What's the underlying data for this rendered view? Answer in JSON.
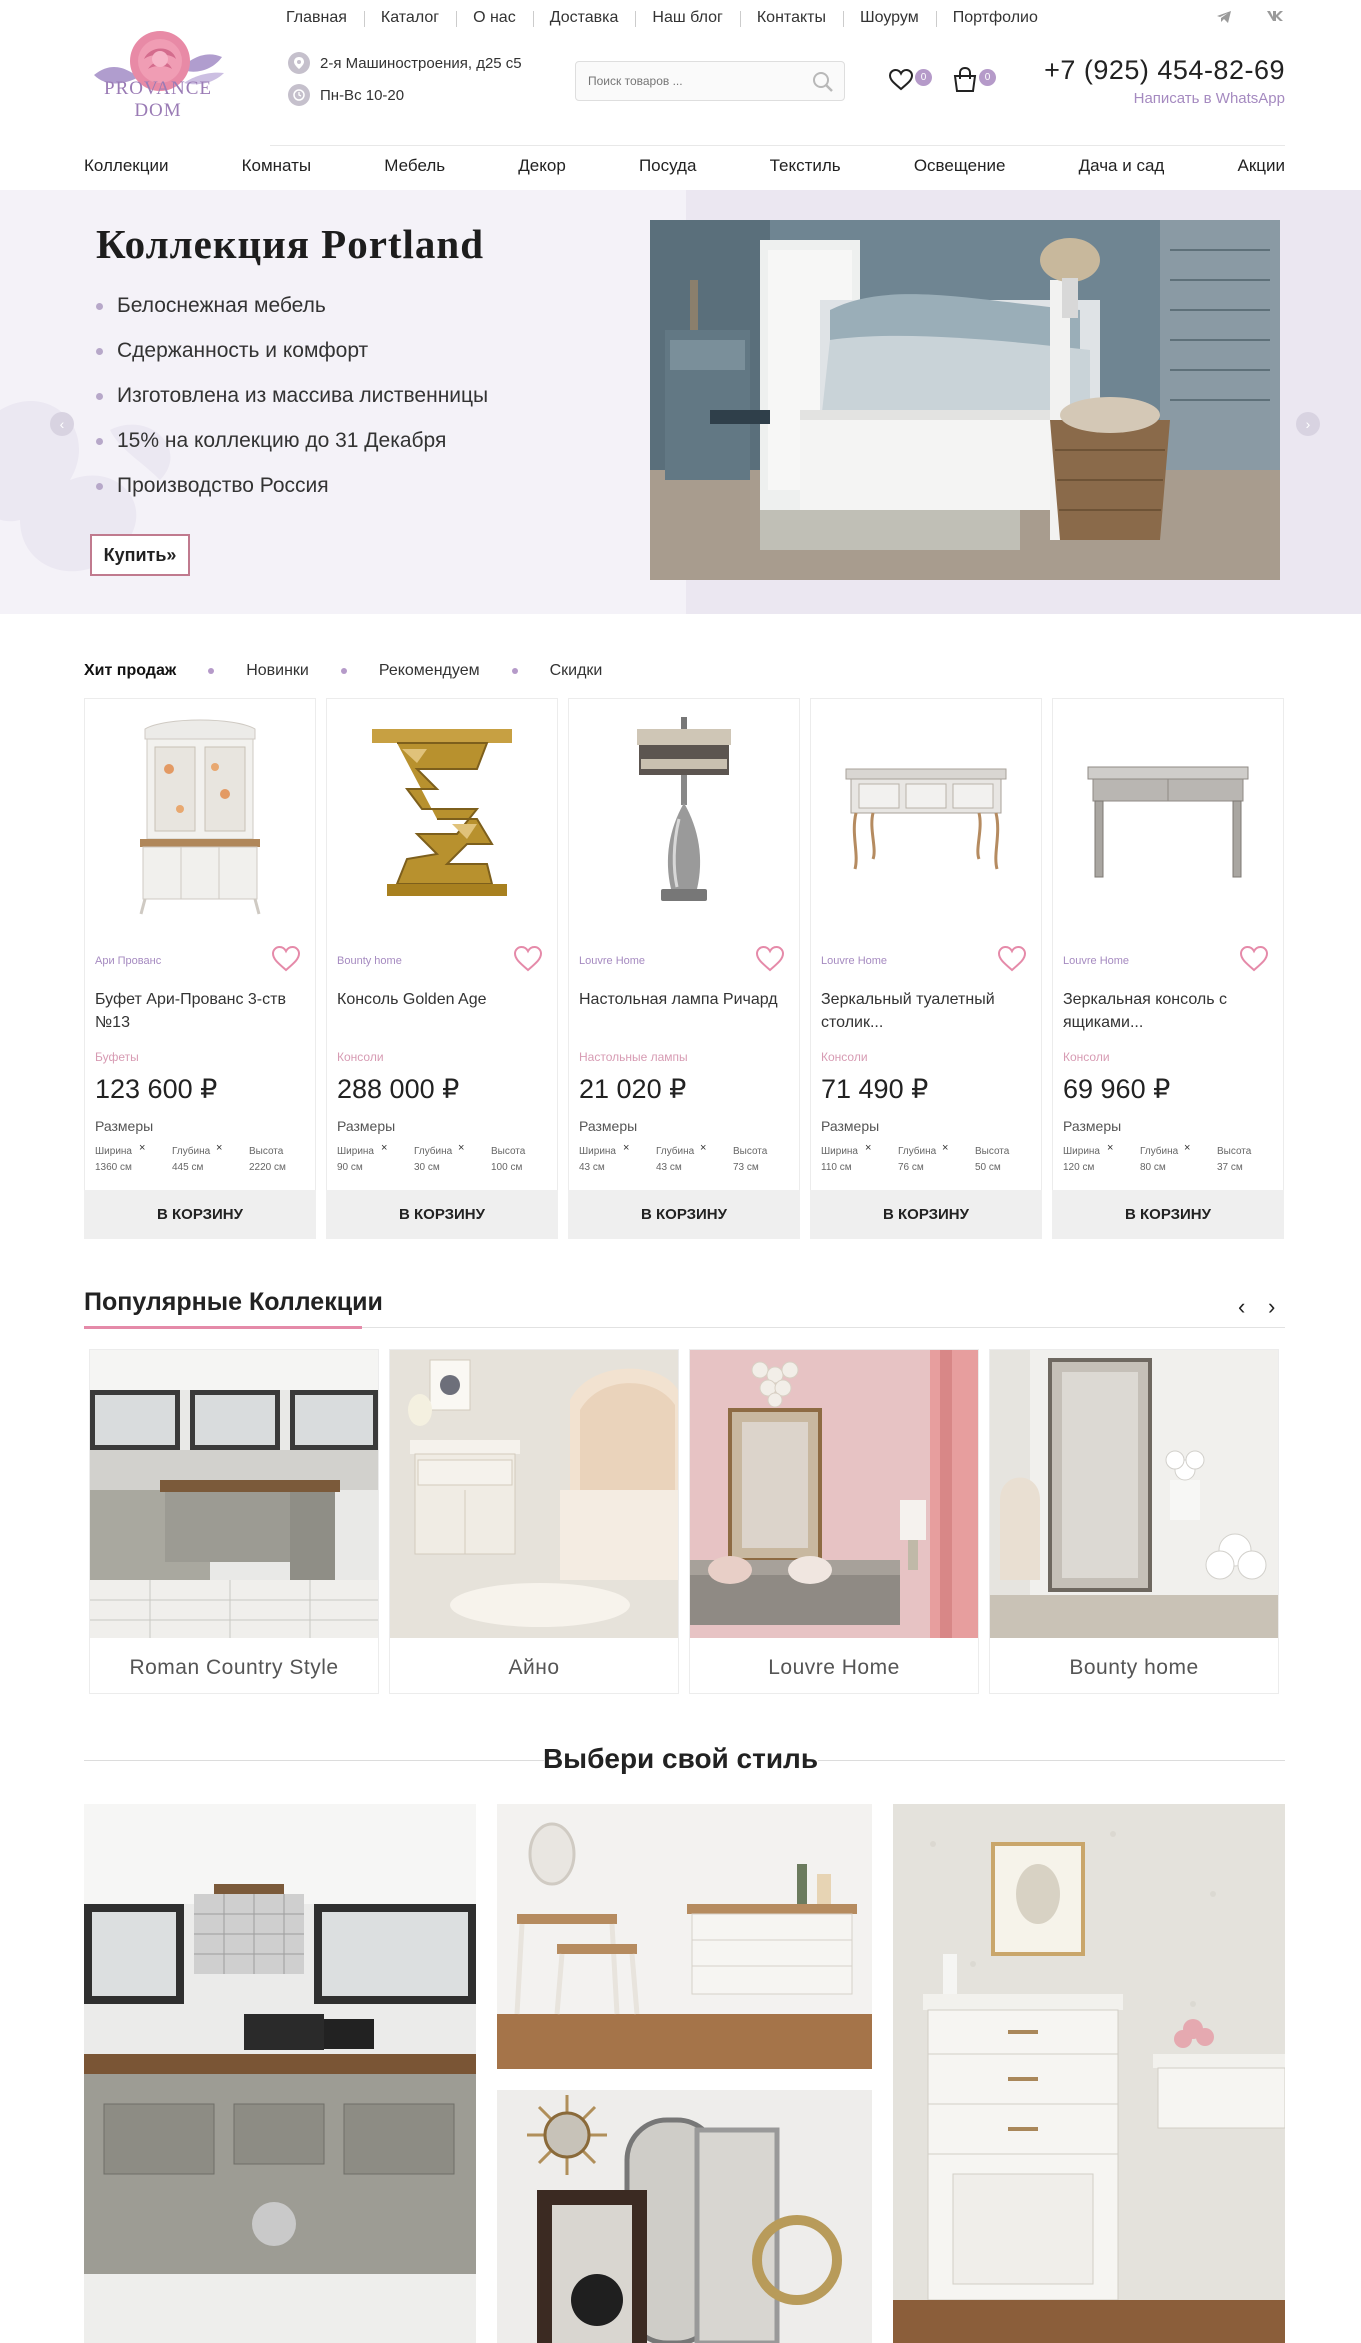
{
  "brand": {
    "line1": "PROVANCE",
    "line2": "DOM"
  },
  "top_nav": [
    "Главная",
    "Каталог",
    "О нас",
    "Доставка",
    "Наш блог",
    "Контакты",
    "Шоурум",
    "Портфолио"
  ],
  "social": {
    "telegram": "telegram-icon",
    "vk": "vk-icon"
  },
  "contact": {
    "address": "2-я Машиностроения, д25 с5",
    "hours": "Пн-Вс 10-20"
  },
  "search": {
    "placeholder": "Поиск товаров ..."
  },
  "header_counts": {
    "favorites": "0",
    "cart": "0"
  },
  "phone": {
    "number": "+7 (925) 454-82-69",
    "whatsapp": "Написать в WhatsApp"
  },
  "main_nav": [
    "Коллекции",
    "Комнаты",
    "Мебель",
    "Декор",
    "Посуда",
    "Текстиль",
    "Освещение",
    "Дача и сад",
    "Акции"
  ],
  "hero": {
    "title": "Коллекция Portland",
    "features": [
      "Белоснежная мебель",
      "Сдержанность и комфорт",
      "Изготовлена из массива лиственницы",
      "15% на коллекцию до 31 Декабря",
      "Производство Россия"
    ],
    "button": "Купить»",
    "arrow_left": "‹",
    "arrow_right": "›"
  },
  "tabs": [
    "Хит продаж",
    "Новинки",
    "Рекомендуем",
    "Скидки"
  ],
  "products": [
    {
      "brand": "Ари Прованс",
      "name": "Буфет Ари-Прованс 3-ств №13",
      "category": "Буфеты",
      "price": "123 600 ₽",
      "sizes_label": "Размеры",
      "dims": [
        {
          "label": "Ширина",
          "value": "1360 см"
        },
        {
          "label": "Глубина",
          "value": "445 см"
        },
        {
          "label": "Высота",
          "value": "2220 см"
        }
      ],
      "cart": "В КОРЗИНУ"
    },
    {
      "brand": "Bounty home",
      "name": "Консоль Golden Age",
      "category": "Консоли",
      "price": "288 000 ₽",
      "sizes_label": "Размеры",
      "dims": [
        {
          "label": "Ширина",
          "value": "90 см"
        },
        {
          "label": "Глубина",
          "value": "30 см"
        },
        {
          "label": "Высота",
          "value": "100 см"
        }
      ],
      "cart": "В КОРЗИНУ"
    },
    {
      "brand": "Louvre Home",
      "name": "Настольная лампа Ричард",
      "category": "Настольные лампы",
      "price": "21 020 ₽",
      "sizes_label": "Размеры",
      "dims": [
        {
          "label": "Ширина",
          "value": "43 см"
        },
        {
          "label": "Глубина",
          "value": "43 см"
        },
        {
          "label": "Высота",
          "value": "73 см"
        }
      ],
      "cart": "В КОРЗИНУ"
    },
    {
      "brand": "Louvre Home",
      "name": "Зеркальный туалетный столик...",
      "category": "Консоли",
      "price": "71 490 ₽",
      "sizes_label": "Размеры",
      "dims": [
        {
          "label": "Ширина",
          "value": "110 см"
        },
        {
          "label": "Глубина",
          "value": "76 см"
        },
        {
          "label": "Высота",
          "value": "50 см"
        }
      ],
      "cart": "В КОРЗИНУ"
    },
    {
      "brand": "Louvre Home",
      "name": "Зеркальная консоль с ящиками...",
      "category": "Консоли",
      "price": "69 960 ₽",
      "sizes_label": "Размеры",
      "dims": [
        {
          "label": "Ширина",
          "value": "120 см"
        },
        {
          "label": "Глубина",
          "value": "80 см"
        },
        {
          "label": "Высота",
          "value": "37 см"
        }
      ],
      "cart": "В КОРЗИНУ"
    }
  ],
  "popular": {
    "title": "Популярные Коллекции",
    "prev": "‹",
    "next": "›",
    "items": [
      "Roman Country Style",
      "Айно",
      "Louvre Home",
      "Bounty home"
    ]
  },
  "styles": {
    "title": "Выбери свой стиль"
  },
  "colors": {
    "accent": "#a58ac0",
    "pink": "#e58aa9",
    "hero_bg": "#f4f2f8"
  }
}
